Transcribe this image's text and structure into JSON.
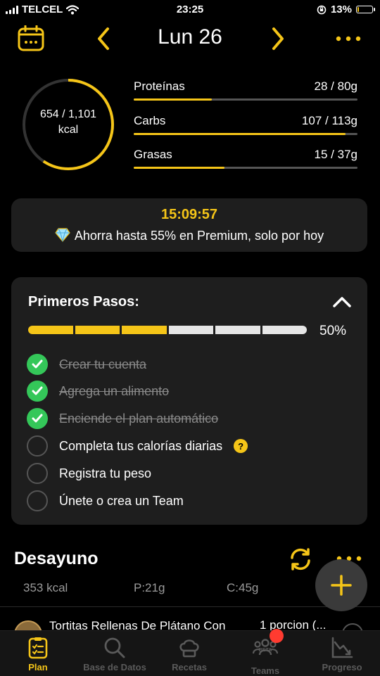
{
  "status_bar": {
    "carrier": "TELCEL",
    "time": "23:25",
    "battery": "13%",
    "battery_level": 0.13
  },
  "header": {
    "title": "Lun 26"
  },
  "calories": {
    "line1": "654 / 1,101",
    "line2": "kcal",
    "consumed": 654,
    "goal": 1101
  },
  "macros": [
    {
      "label": "Proteínas",
      "value": "28 / 80g",
      "current": 28,
      "goal": 80
    },
    {
      "label": "Carbs",
      "value": "107 / 113g",
      "current": 107,
      "goal": 113
    },
    {
      "label": "Grasas",
      "value": "15 / 37g",
      "current": 15,
      "goal": 37
    }
  ],
  "promo": {
    "timer": "15:09:57",
    "message": "Ahorra hasta 55% en Premium, solo por hoy"
  },
  "steps": {
    "title": "Primeros Pasos:",
    "percent": "50%",
    "segments_total": 6,
    "segments_done": 3,
    "items": [
      {
        "label": "Crear tu cuenta",
        "done": true
      },
      {
        "label": "Agrega un alimento",
        "done": true
      },
      {
        "label": "Enciende el plan automático",
        "done": true
      },
      {
        "label": "Completa tus calorías diarias",
        "done": false
      },
      {
        "label": "Registra tu peso",
        "done": false
      },
      {
        "label": "Únete o crea un Team",
        "done": false
      }
    ],
    "help_glyph": "?"
  },
  "meal": {
    "title": "Desayuno",
    "kcal": "353 kcal",
    "protein": "P:21g",
    "carbs": "C:45g",
    "food_name": "Tortitas Rellenas De Plátano Con",
    "food_portion": "1 porcion (..."
  },
  "tabs": [
    {
      "label": "Plan",
      "icon": "clipboard-check-icon",
      "active": true
    },
    {
      "label": "Base de Datos",
      "icon": "search-icon",
      "active": false
    },
    {
      "label": "Recetas",
      "icon": "chef-hat-icon",
      "active": false
    },
    {
      "label": "Teams",
      "icon": "people-icon",
      "badge_text": "BETA",
      "active": false
    },
    {
      "label": "Progreso",
      "icon": "chart-down-icon",
      "active": false
    }
  ],
  "colors": {
    "accent": "#f5c518",
    "success": "#34c759",
    "card": "#1e1e1e",
    "background": "#000000",
    "notification": "#ff3b30"
  }
}
